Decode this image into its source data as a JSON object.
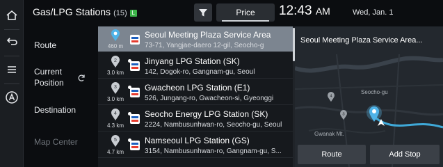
{
  "header": {
    "title": "Gas/LPG Stations",
    "count": "(15)",
    "badge": "L",
    "price_button": "Price",
    "time": "12:43",
    "ampm": "AM",
    "date": "Wed, Jan. 1"
  },
  "rail": {
    "icons": [
      "home-icon",
      "back-icon",
      "menu-icon",
      "assistant-icon"
    ]
  },
  "menu": {
    "route": "Route",
    "current_position_line1": "Current",
    "current_position_line2": "Position",
    "destination": "Destination",
    "map_center": "Map Center"
  },
  "stations": [
    {
      "number": "",
      "distance": "460 m",
      "name": "Seoul Meeting Plaza Service Area",
      "address": "73-71, Yangjae-daero 12-gil, Seocho-g"
    },
    {
      "number": "2",
      "distance": "3.0 km",
      "name": "Jinyang LPG Station (SK)",
      "address": "142, Dogok-ro, Gangnam-gu, Seoul"
    },
    {
      "number": "3",
      "distance": "3.0 km",
      "name": "Gwacheon LPG Station (E1)",
      "address": "526, Jungang-ro, Gwacheon-si, Gyeonggi"
    },
    {
      "number": "4",
      "distance": "4.3 km",
      "name": "Seocho Energy LPG Station (SK)",
      "address": "2224, Nambusunhwan-ro, Seocho-gu, Seoul"
    },
    {
      "number": "5",
      "distance": "4.7 km",
      "name": "Namseoul LPG Station (GS)",
      "address": "3154, Nambusunhwan-ro, Gangnam-gu, S..."
    }
  ],
  "map": {
    "title": "Seoul Meeting Plaza Service Area...",
    "labels": [
      "Seocho-gu",
      "Gwanak Mt."
    ],
    "pin_numbers": [
      "4",
      "3"
    ],
    "route_button": "Route",
    "add_stop_button": "Add Stop"
  },
  "colors": {
    "background": "#0b0d10",
    "selected_row": "#7c8590",
    "route_line": "#3fa9d8",
    "lpg_badge": "#3db54a"
  }
}
